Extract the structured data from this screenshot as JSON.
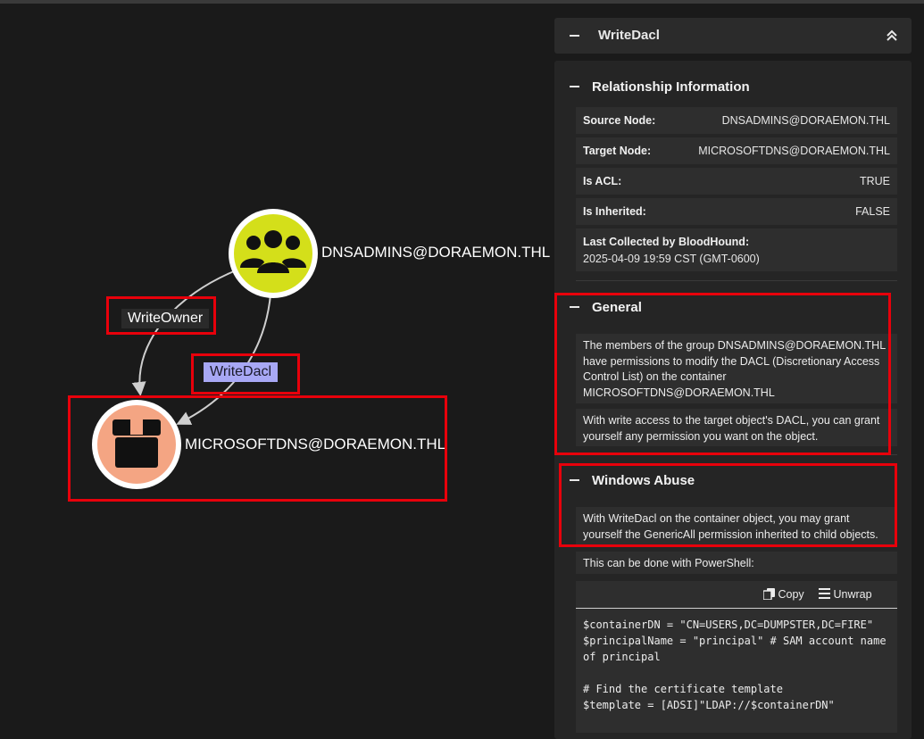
{
  "graph": {
    "nodes": [
      {
        "id": "dnsadmins",
        "label": "DNSADMINS@DORAEMON.THL",
        "kind": "group",
        "color": "#d4df1a"
      },
      {
        "id": "microsoftdns",
        "label": "MICROSOFTDNS@DORAEMON.THL",
        "kind": "container",
        "color": "#f4a583"
      }
    ],
    "edges": [
      {
        "label": "WriteOwner"
      },
      {
        "label": "WriteDacl"
      }
    ]
  },
  "panel": {
    "title": "WriteDacl",
    "relationship": {
      "title": "Relationship Information",
      "rows": [
        {
          "key": "Source Node:",
          "value": "DNSADMINS@DORAEMON.THL"
        },
        {
          "key": "Target Node:",
          "value": "MICROSOFTDNS@DORAEMON.THL"
        },
        {
          "key": "Is ACL:",
          "value": "TRUE"
        },
        {
          "key": "Is Inherited:",
          "value": "FALSE"
        }
      ],
      "last_collected": {
        "key": "Last Collected by BloodHound:",
        "value": "2025-04-09 19:59 CST (GMT-0600)"
      }
    },
    "general": {
      "title": "General",
      "paragraphs": [
        "The members of the group DNSADMINS@DORAEMON.THL have permissions to modify the DACL (Discretionary Access Control List) on the container MICROSOFTDNS@DORAEMON.THL",
        "With write access to the target object's DACL, you can grant yourself any permission you want on the object."
      ]
    },
    "windows_abuse": {
      "title": "Windows Abuse",
      "paragraphs": [
        "With WriteDacl on the container object, you may grant yourself the GenericAll permission inherited to child objects.",
        "This can be done with PowerShell:"
      ],
      "copy_label": "Copy",
      "unwrap_label": "Unwrap",
      "code": "$containerDN = \"CN=USERS,DC=DUMPSTER,DC=FIRE\"\n$principalName = \"principal\" # SAM account name\nof principal\n\n# Find the certificate template\n$template = [ADSI]\"LDAP://$containerDN\""
    }
  },
  "colors": {
    "highlight": "#e8000b",
    "writedacl_label_bg": "#a8a8f5"
  }
}
